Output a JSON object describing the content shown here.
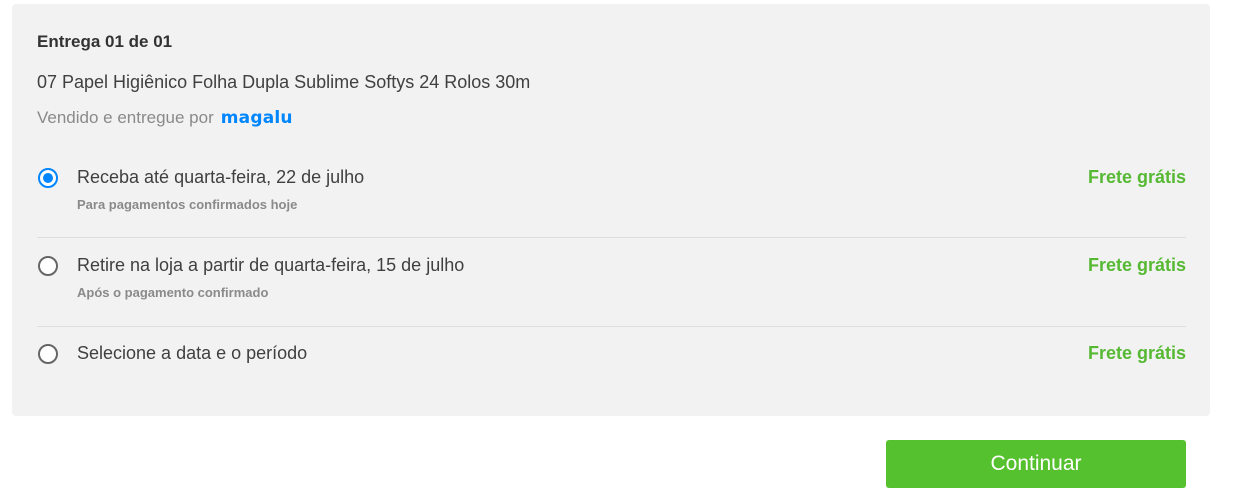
{
  "delivery": {
    "title": "Entrega 01 de 01",
    "product": "07 Papel Higiênico Folha Dupla Sublime Softys 24 Rolos 30m",
    "seller_prefix": "Vendido e entregue por",
    "seller_logo_text": "magalu"
  },
  "options": [
    {
      "label": "Receba até quarta-feira, 22 de julho",
      "sublabel": "Para pagamentos confirmados hoje",
      "price": "Frete grátis",
      "selected": true
    },
    {
      "label": "Retire na loja a partir de quarta-feira, 15 de julho",
      "sublabel": "Após o pagamento confirmado",
      "price": "Frete grátis",
      "selected": false
    },
    {
      "label": "Selecione a data e o período",
      "price": "Frete grátis",
      "selected": false
    }
  ],
  "actions": {
    "continue_label": "Continuar"
  },
  "colors": {
    "accent_blue": "#0086ff",
    "free_shipping_green": "#56b934",
    "button_green": "#56c12e",
    "panel_bg": "#f2f2f2"
  }
}
